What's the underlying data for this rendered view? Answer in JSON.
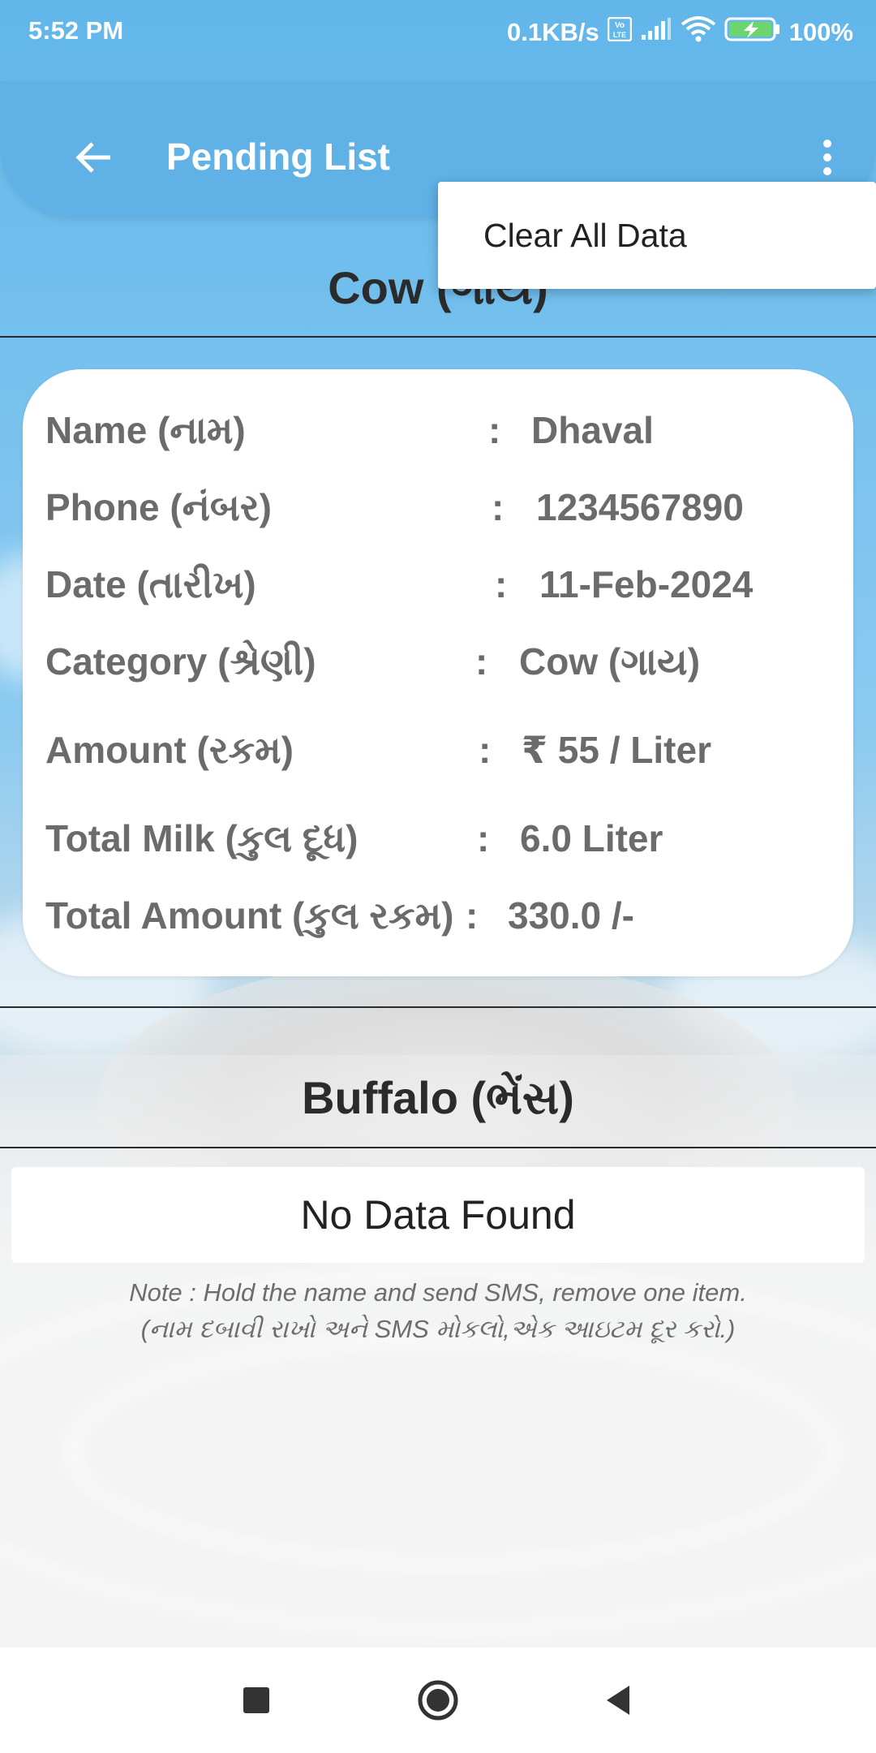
{
  "status_bar": {
    "time": "5:52 PM",
    "network_speed": "0.1KB/s",
    "volte_label": "Vo LTE",
    "battery": "100%"
  },
  "app_bar": {
    "title": "Pending List",
    "back_icon": "arrow-left-icon",
    "menu_icon": "more-vert-icon"
  },
  "popup_menu": {
    "items": [
      {
        "label": "Clear All Data"
      }
    ]
  },
  "cow_section": {
    "title": "Cow (ગાય)",
    "record": {
      "rows": [
        {
          "label": "Name (નામ)",
          "colon": ":",
          "value": "Dhaval"
        },
        {
          "label": "Phone (નંબર)",
          "colon": ":",
          "value": "1234567890"
        },
        {
          "label": "Date (તારીખ)",
          "colon": ":",
          "value": "11-Feb-2024"
        },
        {
          "label": "Category (શ્રેણી)",
          "colon": ":",
          "value": "Cow (ગાય)"
        },
        {
          "label": "Amount (રકમ)",
          "colon": ":",
          "value": "₹ 55 / Liter"
        },
        {
          "label": "Total Milk (કુલ દૂધ)",
          "colon": ":",
          "value": "6.0 Liter"
        },
        {
          "label": "Total Amount (કુલ રકમ)",
          "colon": ":",
          "value": "330.0 /-"
        }
      ]
    }
  },
  "buffalo_section": {
    "title": "Buffalo (ભેંસ)",
    "empty_text": "No Data Found"
  },
  "note": {
    "line1": "Note : Hold the name and send SMS, remove one item.",
    "line2": "(નામ દબાવી રાખો અને SMS મોકલો,એક આઇટમ દૂર કરો.)"
  },
  "nav_bar": {
    "recents_icon": "square-icon",
    "home_icon": "circle-icon",
    "back_icon": "triangle-back-icon"
  },
  "colors": {
    "app_bar": "#5fb1e6",
    "sky": "#74c0ee",
    "card": "#ffffff",
    "label_text": "#6b6b6b",
    "heading_text": "#2b2b2b"
  }
}
